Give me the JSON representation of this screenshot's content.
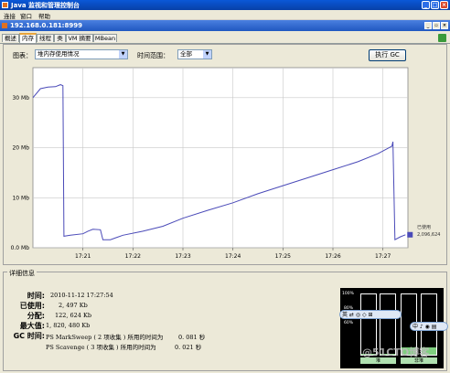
{
  "window": {
    "title": "Java 监视和管理控制台"
  },
  "menu": [
    "连接",
    "窗口",
    "帮助"
  ],
  "connection": {
    "title": "192.168.0.181:8999"
  },
  "tabs": [
    "概述",
    "内存",
    "线程",
    "类",
    "VM 摘要",
    "MBean"
  ],
  "active_tab": "内存",
  "controls": {
    "chart_label": "图表：",
    "chart_value": "堆内存使用情况",
    "range_label": "时间范围：",
    "range_value": "全部",
    "gc_button": "执行 GC"
  },
  "chart_data": {
    "type": "line",
    "yticks": [
      "0.0 Mb",
      "10 Mb",
      "20 Mb",
      "30 Mb"
    ],
    "yvalues": [
      0,
      10,
      20,
      30
    ],
    "xticks": [
      "17:21",
      "17:22",
      "17:23",
      "17:24",
      "17:25",
      "17:26",
      "17:27"
    ],
    "ylim": [
      0,
      36
    ],
    "xlim": [
      0,
      7.5
    ],
    "series": [
      {
        "color": "#4a4ab8",
        "points": [
          [
            0.0,
            30.0
          ],
          [
            0.15,
            31.8
          ],
          [
            0.3,
            32.1
          ],
          [
            0.45,
            32.2
          ],
          [
            0.55,
            32.6
          ],
          [
            0.6,
            32.4
          ],
          [
            0.62,
            2.3
          ],
          [
            0.75,
            2.5
          ],
          [
            1.0,
            2.8
          ],
          [
            1.1,
            3.3
          ],
          [
            1.2,
            3.7
          ],
          [
            1.35,
            3.6
          ],
          [
            1.4,
            1.6
          ],
          [
            1.55,
            1.6
          ],
          [
            1.8,
            2.5
          ],
          [
            2.2,
            3.3
          ],
          [
            2.6,
            4.3
          ],
          [
            3.0,
            5.9
          ],
          [
            3.5,
            7.5
          ],
          [
            4.0,
            9.0
          ],
          [
            4.5,
            10.8
          ],
          [
            5.0,
            12.4
          ],
          [
            5.5,
            14.0
          ],
          [
            6.0,
            15.6
          ],
          [
            6.5,
            17.2
          ],
          [
            6.9,
            18.8
          ],
          [
            7.05,
            19.6
          ],
          [
            7.18,
            20.3
          ],
          [
            7.2,
            21.2
          ],
          [
            7.24,
            1.6
          ],
          [
            7.35,
            2.2
          ],
          [
            7.45,
            2.6
          ]
        ]
      }
    ],
    "end_labels": [
      "已使用",
      "2,096,624"
    ]
  },
  "details": {
    "title": "详细信息",
    "time_label": "时间:",
    "time_value": "2010-11-12 17:27:54",
    "used_label": "已使用:",
    "used_value": "2, 497 Kb",
    "committed_label": "分配:",
    "committed_value": "122, 624 Kb",
    "max_label": "最大值:",
    "max_value": "1, 820, 480 Kb",
    "gc_time_label": "GC 时间:",
    "gc1": "PS MarkSweep ( 2 项收集 ) 所用的时间为",
    "gc1_time": "0. 081 秒",
    "gc2": "PS Scavenge ( 3 项收集 ) 所用的时间为",
    "gc2_time": "0. 021 秒"
  },
  "heap_bars": {
    "ticks": [
      "100%",
      "80%",
      "60%"
    ],
    "labels": [
      "堆",
      "非堆"
    ],
    "heap_fill": 0.02,
    "nonheap_fill": 0.12
  },
  "floating_toolbars": [
    "英 ⇄ ◎ ◇ ⊞",
    "中 ♪ ◉ ▤"
  ],
  "watermark": "@51CTO博客"
}
